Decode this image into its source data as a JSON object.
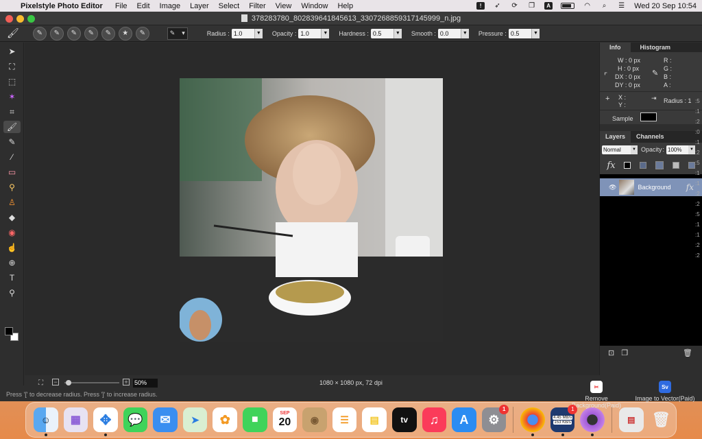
{
  "menubar": {
    "app_name": "Pixelstyle Photo Editor",
    "menus": [
      "File",
      "Edit",
      "Image",
      "Layer",
      "Select",
      "Filter",
      "View",
      "Window",
      "Help"
    ],
    "input_indicator": "A",
    "clock": "Wed 20 Sep  10:54"
  },
  "window": {
    "title": "378283780_802839641845613_3307268859317145999_n.jpg"
  },
  "options": {
    "radius_label": "Radius :",
    "radius_value": "1.0",
    "opacity_label": "Opacity :",
    "opacity_value": "1.0",
    "hardness_label": "Hardness :",
    "hardness_value": "0.5",
    "smooth_label": "Smooth :",
    "smooth_value": "0.0",
    "pressure_label": "Pressure :",
    "pressure_value": "0.5"
  },
  "status": {
    "zoom": "50%",
    "doc_info": "1080 × 1080 px, 72 dpi",
    "hint": "Press '[' to decrease radius. Press ']' to increase radius."
  },
  "info_panel": {
    "tab_info": "Info",
    "tab_histogram": "Histogram",
    "w": "W :  0 px",
    "h": "H :  0 px",
    "dx": "DX :  0 px",
    "dy": "DY :  0 px",
    "r": "R :",
    "g": "G :",
    "b": "B :",
    "a": "A :",
    "x": "X :",
    "y": "Y :",
    "radius": "Radius :   1",
    "sample": "Sample"
  },
  "layers_panel": {
    "tab_layers": "Layers",
    "tab_channels": "Channels",
    "blend_mode": "Normal",
    "opacity_label": "Opacity",
    "opacity_value": "100%",
    "fx": "fx",
    "layers": [
      {
        "name": "Background"
      }
    ]
  },
  "plugins": {
    "remove_bg": "Remove Background(Paid)",
    "vector": "Image to Vector(Paid)",
    "vector_icon_text": "Sv"
  },
  "dock": {
    "calendar_month": "SEP",
    "calendar_day": "20",
    "appletv_label": "tv",
    "settings_badge": "1",
    "netspeed_badge": "1",
    "net_up": "4.45 MB/s",
    "net_down": "153 KB/s"
  },
  "edge_text": [
    ":5",
    ":1",
    ":2",
    ":0",
    ":1",
    ":2",
    ":5",
    ":1",
    ":1",
    ":2",
    ":2",
    ":5",
    ":1",
    ":1",
    ":2",
    ":2"
  ]
}
